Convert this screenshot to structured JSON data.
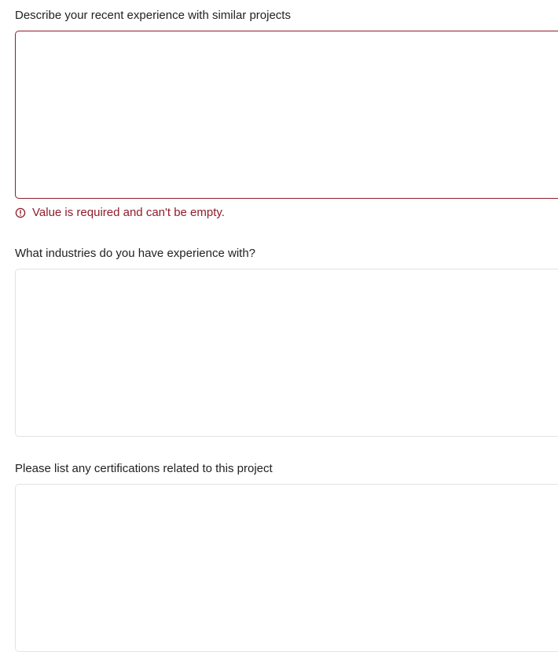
{
  "fields": [
    {
      "label": "Describe your recent experience with similar projects",
      "value": "",
      "placeholder": "",
      "error": "Value is required and can't be empty."
    },
    {
      "label": "What industries do you have experience with?",
      "value": "",
      "placeholder": ""
    },
    {
      "label": "Please list any certifications related to this project",
      "value": "",
      "placeholder": ""
    }
  ],
  "icons": {
    "error": "alert-circle-icon"
  },
  "colors": {
    "error": "#8f1d2c",
    "border": "#e3e3e3",
    "label": "#222222"
  }
}
